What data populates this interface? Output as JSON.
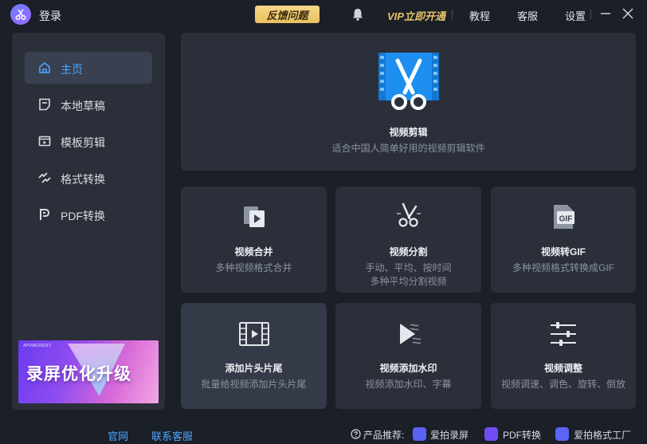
{
  "titlebar": {
    "login": "登录",
    "feedback": "反馈问题",
    "vip": "VIP立即开通",
    "tutorial": "教程",
    "service": "客服",
    "settings": "设置"
  },
  "sidebar": {
    "items": [
      {
        "label": "主页",
        "icon": "home-icon",
        "active": true
      },
      {
        "label": "本地草稿",
        "icon": "draft-icon",
        "active": false
      },
      {
        "label": "模板剪辑",
        "icon": "template-icon",
        "active": false
      },
      {
        "label": "格式转换",
        "icon": "convert-icon",
        "active": false
      },
      {
        "label": "PDF转换",
        "icon": "pdf-icon",
        "active": false
      }
    ],
    "banner": {
      "text": "录屏优化升级",
      "tag": "APOWERSOFT"
    }
  },
  "hero": {
    "title": "视频剪辑",
    "desc": "适合中国人简单好用的视频剪辑软件"
  },
  "tools": [
    {
      "title": "视频合并",
      "desc1": "多种视频格式合并",
      "desc2": ""
    },
    {
      "title": "视频分割",
      "desc1": "手动、平均、按时间",
      "desc2": "多种平均分割视频"
    },
    {
      "title": "视频转GIF",
      "desc1": "多种视频格式转换成GIF",
      "desc2": ""
    },
    {
      "title": "添加片头片尾",
      "desc1": "批量给视频添加片头片尾",
      "desc2": ""
    },
    {
      "title": "视频添加水印",
      "desc1": "视频添加水印、字幕",
      "desc2": ""
    },
    {
      "title": "视频调整",
      "desc1": "视频调速、调色、旋转、倒放",
      "desc2": ""
    }
  ],
  "gif_badge": "GIF",
  "footer": {
    "website": "官网",
    "contact": "联系客服",
    "recommend": "产品推荐:",
    "products": [
      "爱拍录屏",
      "PDF转换",
      "爱拍格式工厂"
    ]
  },
  "colors": {
    "accent": "#4aa8ff",
    "vip": "#e7c46a",
    "background": "#1b1f27",
    "card": "#2a2f3a"
  }
}
